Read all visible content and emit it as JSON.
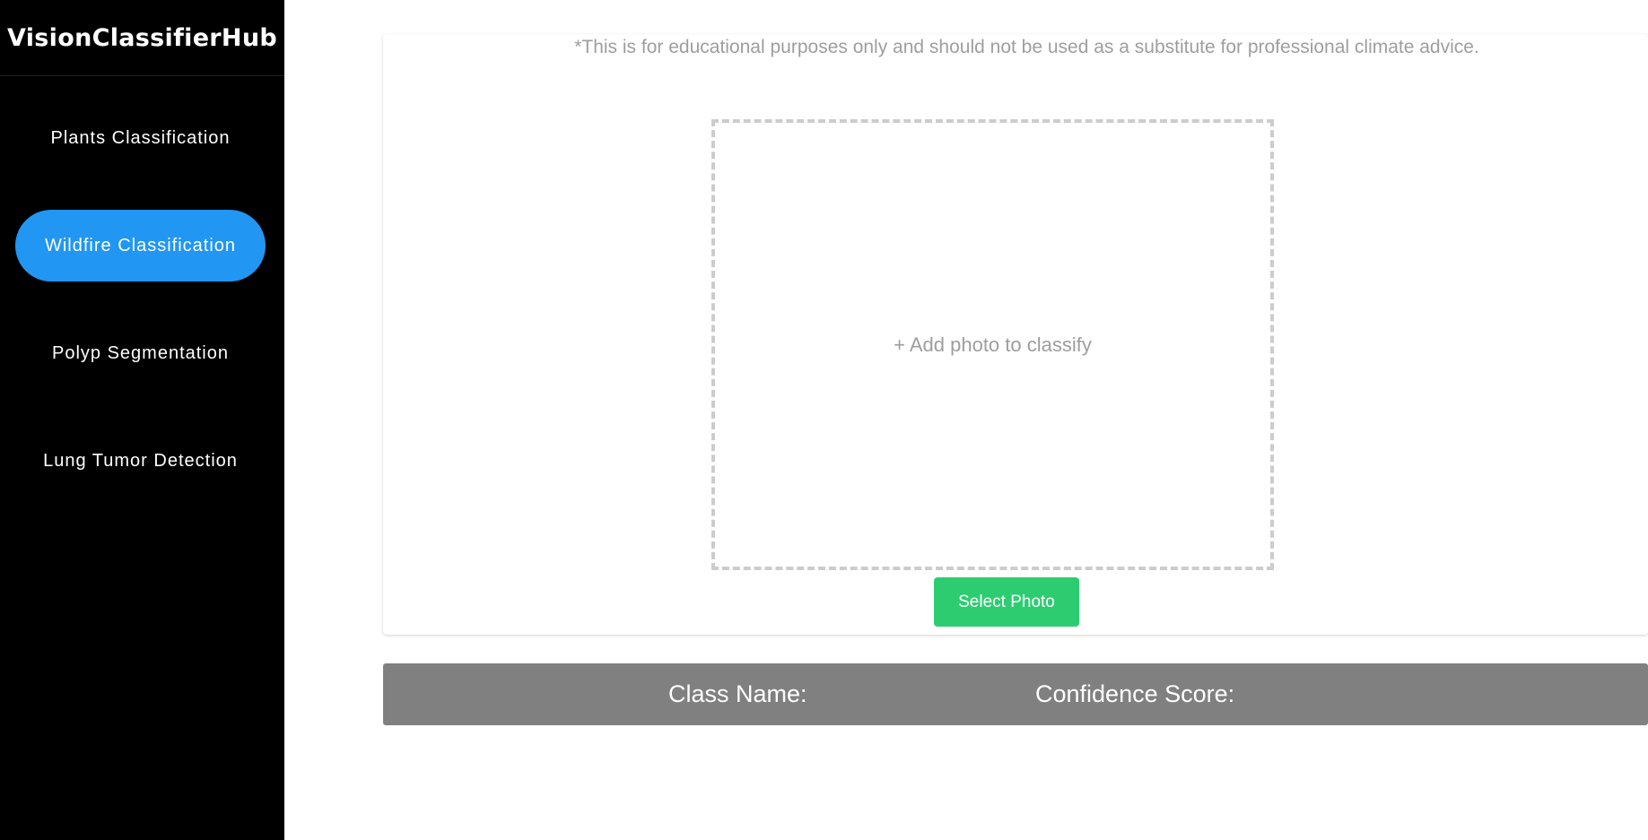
{
  "brand": {
    "title": "VisionClassifierHub"
  },
  "nav": {
    "items": [
      {
        "label": "Plants Classification",
        "active": false
      },
      {
        "label": "Wildfire Classification",
        "active": true
      },
      {
        "label": "Polyp Segmentation",
        "active": false
      },
      {
        "label": "Lung Tumor Detection",
        "active": false
      }
    ]
  },
  "upload": {
    "disclaimer": "*This is for educational purposes only and should not be used as a substitute for professional climate advice.",
    "dropzone_label": "+ Add photo to classify",
    "select_button": "Select Photo"
  },
  "results": {
    "class_name_label": "Class Name:",
    "confidence_label": "Confidence Score:"
  },
  "colors": {
    "sidebar_bg": "#000000",
    "active_nav": "#2196f3",
    "select_button": "#2ecc71",
    "results_bar": "#808080"
  }
}
